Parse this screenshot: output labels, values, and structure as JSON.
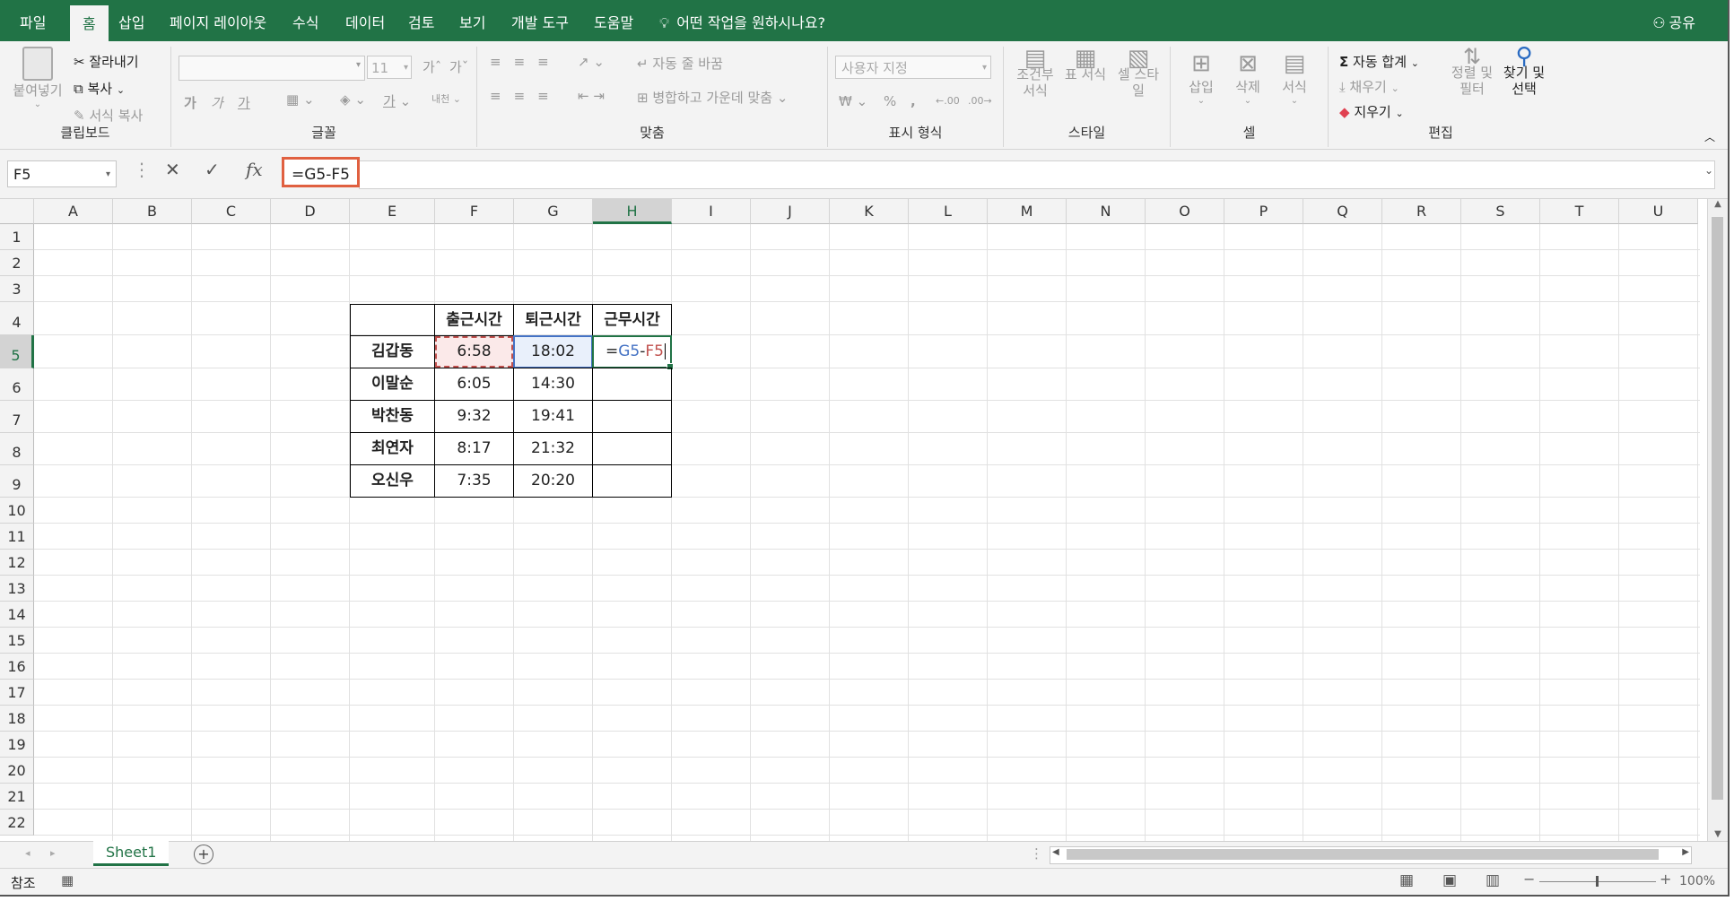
{
  "tabs": [
    "파일",
    "홈",
    "삽입",
    "페이지 레이아웃",
    "수식",
    "데이터",
    "검토",
    "보기",
    "개발 도구",
    "도움말"
  ],
  "active_tab": "홈",
  "tell_me": "어떤 작업을 원하시나요?",
  "share": "공유",
  "clipboard": {
    "paste": "붙여넣기",
    "cut": "잘라내기",
    "copy": "복사",
    "format_painter": "서식 복사",
    "label": "클립보드"
  },
  "font": {
    "size": "11",
    "bold": "가",
    "italic": "가",
    "underline": "가",
    "label": "글꼴"
  },
  "alignment": {
    "wrap": "자동 줄 바꿈",
    "merge": "병합하고 가운데 맞춤",
    "label": "맞춤"
  },
  "number": {
    "format": "사용자 지정",
    "percent": "%",
    "comma": ",",
    "label": "표시 형식"
  },
  "styles": {
    "conditional": "조건부 서식",
    "table": "표 서식",
    "cell": "셀 스타일",
    "label": "스타일"
  },
  "cells": {
    "insert": "삽입",
    "delete": "삭제",
    "format": "서식",
    "label": "셀"
  },
  "editing": {
    "autosum": "자동 합계",
    "fill": "채우기",
    "clear": "지우기",
    "sort": "정렬 및 필터",
    "find": "찾기 및 선택",
    "label": "편집"
  },
  "name_box": "F5",
  "formula": "=G5-F5",
  "columns": [
    "A",
    "B",
    "C",
    "D",
    "E",
    "F",
    "G",
    "H",
    "I",
    "J",
    "K",
    "L",
    "M",
    "N",
    "O",
    "P",
    "Q",
    "R",
    "S",
    "T",
    "U"
  ],
  "rows": [
    "1",
    "2",
    "3",
    "4",
    "5",
    "6",
    "7",
    "8",
    "9",
    "10",
    "11",
    "12",
    "13",
    "14",
    "15",
    "16",
    "17",
    "18",
    "19",
    "20",
    "21",
    "22"
  ],
  "table": {
    "headers": [
      "출근시간",
      "퇴근시간",
      "근무시간"
    ],
    "records": [
      {
        "name": "김갑동",
        "in": "6:58",
        "out": "18:02",
        "work": "=G5-F5"
      },
      {
        "name": "이말순",
        "in": "6:05",
        "out": "14:30",
        "work": ""
      },
      {
        "name": "박찬동",
        "in": "9:32",
        "out": "19:41",
        "work": ""
      },
      {
        "name": "최연자",
        "in": "8:17",
        "out": "21:32",
        "work": ""
      },
      {
        "name": "오신우",
        "in": "7:35",
        "out": "20:20",
        "work": ""
      }
    ]
  },
  "sheet_tab": "Sheet1",
  "status": {
    "mode": "참조",
    "zoom": "100%"
  },
  "colors": {
    "accent": "#217346",
    "formula_border": "#e06040",
    "ref_red": "#c0504d",
    "ref_blue": "#4472c4"
  }
}
